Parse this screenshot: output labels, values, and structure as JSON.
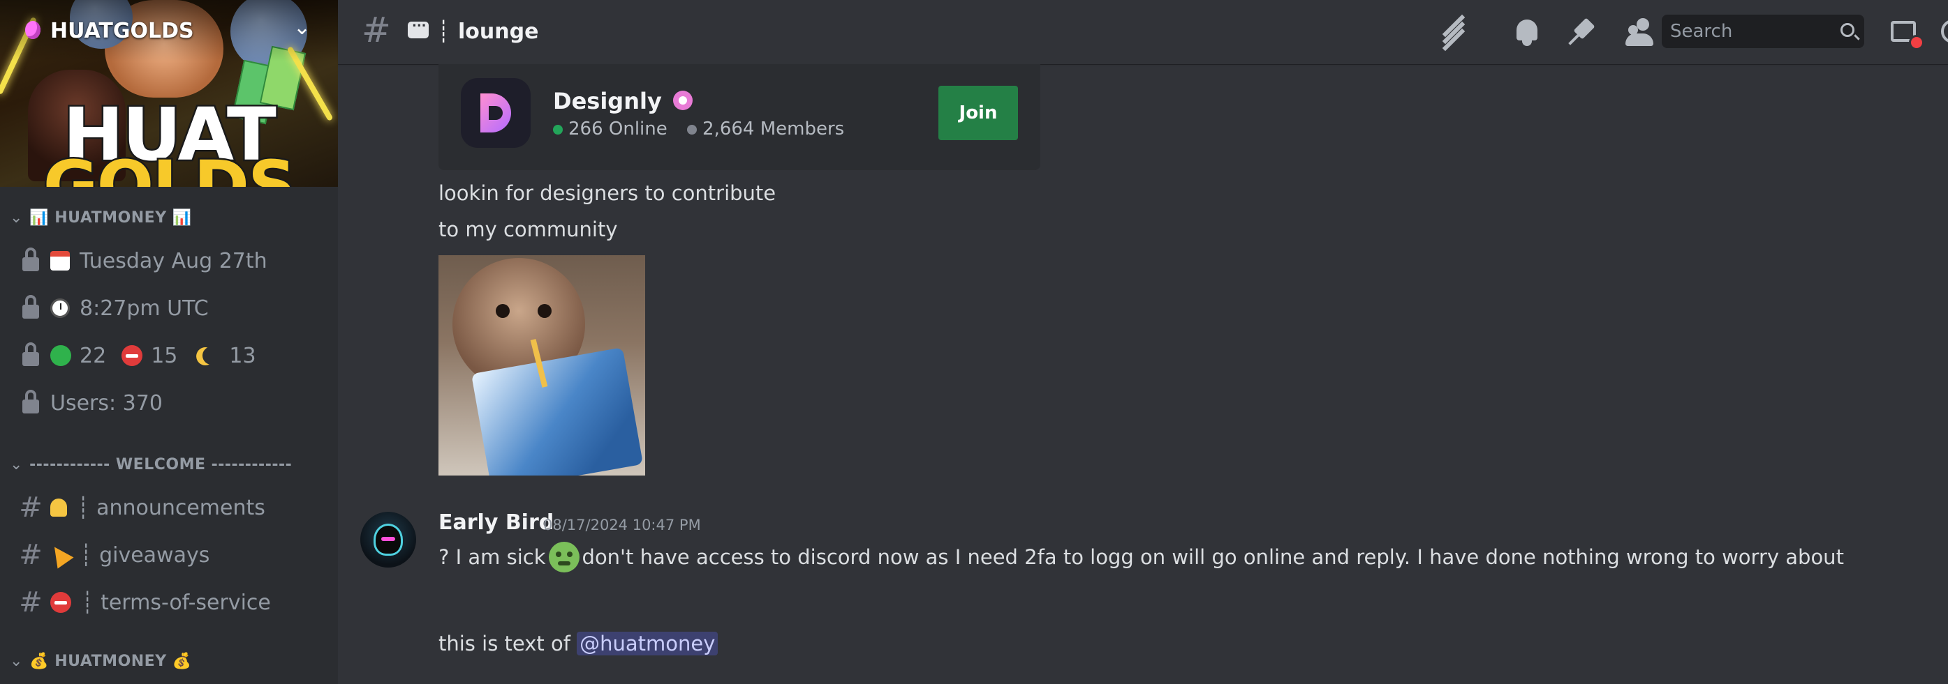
{
  "server": {
    "name": "HUATGOLDS",
    "banner_line1": "HUAT",
    "banner_line2": "GOLDS"
  },
  "sidebar": {
    "categories": [
      {
        "label": "HUATMONEY",
        "emoji": "📊"
      },
      {
        "label": "------------ WELCOME ------------"
      },
      {
        "label": "HUATMONEY",
        "emoji": "💰"
      }
    ],
    "stat_channels": {
      "date": "Tuesday Aug 27th",
      "time": "8:27pm UTC",
      "online": "22",
      "dnd": "15",
      "idle": "13",
      "users": "Users: 370"
    },
    "text_channels": [
      {
        "name": "announcements",
        "separator": "┊"
      },
      {
        "name": "giveaways",
        "separator": "┊"
      },
      {
        "name": "terms-of-service",
        "separator": "┊"
      }
    ]
  },
  "header": {
    "channel_separator": "┊",
    "channel_name": "lounge",
    "search_placeholder": "Search"
  },
  "invite": {
    "server_name": "Designly",
    "online": "266 Online",
    "members": "2,664 Members",
    "join_label": "Join"
  },
  "messages": {
    "line1": "lookin for designers to contribute",
    "line2": "to my community",
    "author": "Early Bird",
    "timestamp": "08/17/2024 10:47 PM",
    "text_a": "? I am sick",
    "text_b": "don't have access to discord now as I need 2fa to logg on  will go online and reply. I have done nothing wrong to worry about",
    "text_c": "this is text of",
    "mention": "@huatmoney"
  },
  "colors": {
    "background": "#313338",
    "sidebar": "#2b2d31",
    "join_green": "#248046",
    "online_green": "#23a55a",
    "mention": "#5865f2"
  },
  "icons": [
    "threads-icon",
    "bell-icon",
    "pin-icon",
    "members-icon",
    "search-icon",
    "inbox-icon",
    "help-icon",
    "lock-icon",
    "hash-icon"
  ]
}
